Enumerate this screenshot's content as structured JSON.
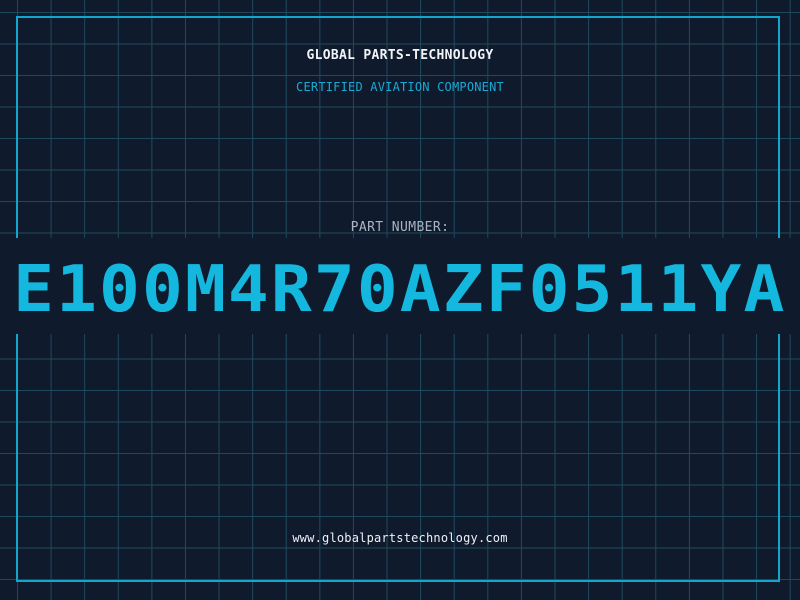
{
  "label": {
    "brand": "GLOBAL PARTS-TECHNOLOGY",
    "tagline": "CERTIFIED AVIATION COMPONENT",
    "part_number_label": "PART NUMBER:",
    "part_number": "E100M4R70AZF0511YA",
    "website": "www.globalpartstechnology.com"
  },
  "colors": {
    "background": "#101a2d",
    "grid": "#1f4a5e",
    "accent": "#12a6cf",
    "text": "#f2f4f7",
    "muted": "#aab4c3"
  }
}
